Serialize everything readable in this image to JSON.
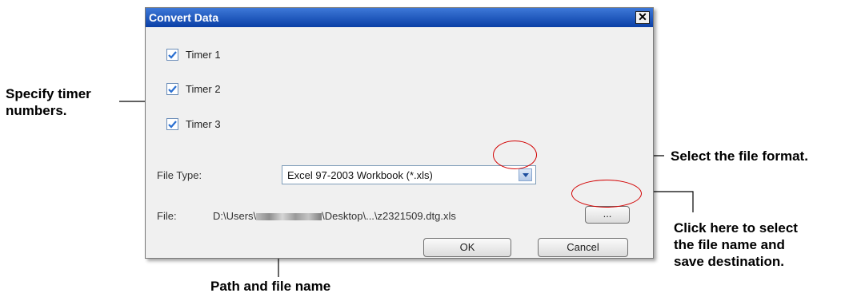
{
  "dialog": {
    "title": "Convert Data",
    "close_label": "✕",
    "timers": [
      {
        "label": "Timer 1",
        "checked": true
      },
      {
        "label": "Timer 2",
        "checked": true
      },
      {
        "label": "Timer 3",
        "checked": true
      }
    ],
    "file_type_label": "File Type:",
    "file_type_value": "Excel 97-2003 Workbook (*.xls)",
    "file_label": "File:",
    "file_path_prefix": "D:\\Users\\",
    "file_path_suffix": "\\Desktop\\...\\z2321509.dtg.xls",
    "browse_label": "...",
    "ok_label": "OK",
    "cancel_label": "Cancel"
  },
  "annotations": {
    "timers_line1": "Specify timer",
    "timers_line2": "numbers.",
    "format": "Select the file format.",
    "browse_line1": "Click here to select",
    "browse_line2": "the file name and",
    "browse_line3": "save destination.",
    "path": "Path and file name"
  },
  "colors": {
    "accent": "#0a3fa6",
    "highlight": "#d20000",
    "check": "#2a6fd1"
  }
}
